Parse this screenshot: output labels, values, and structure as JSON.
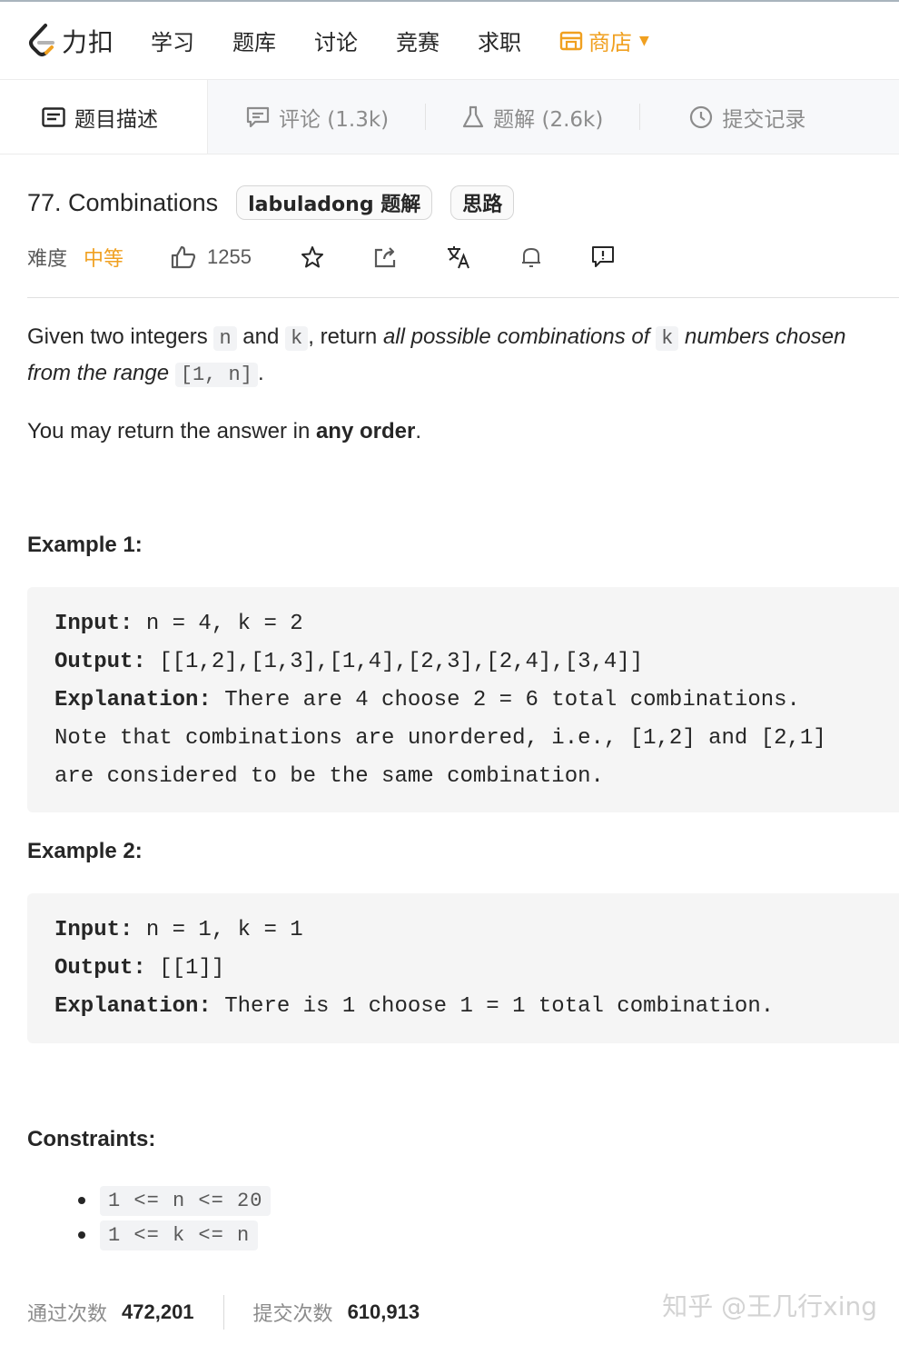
{
  "topbar": {
    "logo_text": "力扣",
    "nav": [
      "学习",
      "题库",
      "讨论",
      "竞赛",
      "求职"
    ],
    "store_label": "商店",
    "store_color": "#f0a020"
  },
  "tabs": [
    {
      "label": "题目描述",
      "icon": "description-icon",
      "active": true
    },
    {
      "label": "评论 (1.3k)",
      "icon": "comment-icon",
      "active": false
    },
    {
      "label": "题解 (2.6k)",
      "icon": "flask-icon",
      "active": false
    },
    {
      "label": "提交记录",
      "icon": "clock-icon",
      "active": false
    }
  ],
  "problem": {
    "title": "77. Combinations",
    "chips": [
      "labuladong 题解",
      "思路"
    ],
    "difficulty_label": "难度",
    "difficulty": "中等",
    "likes": "1255"
  },
  "content": {
    "p1": {
      "t1": "Given two integers ",
      "c1": "n",
      "t2": " and ",
      "c2": "k",
      "t3": ", return ",
      "e1": "all possible combinations of ",
      "c3": "k",
      "e2": " numbers chosen from the range ",
      "c4": "[1, n]",
      "t4": "."
    },
    "p2": {
      "t1": "You may return the answer in ",
      "b1": "any order",
      "t2": "."
    },
    "example1": {
      "title": "Example 1:",
      "input_label": "Input:",
      "input": " n = 4, k = 2",
      "output_label": "Output:",
      "output": " [[1,2],[1,3],[1,4],[2,3],[2,4],[3,4]]",
      "explanation_label": "Explanation:",
      "explanation": " There are 4 choose 2 = 6 total combinations.",
      "explanation_l2": "Note that combinations are unordered, i.e., [1,2] and [2,1]",
      "explanation_l3": "are considered to be the same combination."
    },
    "example2": {
      "title": "Example 2:",
      "input_label": "Input:",
      "input": " n = 1, k = 1",
      "output_label": "Output:",
      "output": " [[1]]",
      "explanation_label": "Explanation:",
      "explanation": " There is 1 choose 1 = 1 total combination."
    },
    "constraints_title": "Constraints:",
    "constraints": [
      "1 <= n <= 20",
      "1 <= k <= n"
    ]
  },
  "stats": {
    "accepted_label": "通过次数",
    "accepted": "472,201",
    "submitted_label": "提交次数",
    "submitted": "610,913"
  },
  "watermark": "知乎 @王几行xing"
}
